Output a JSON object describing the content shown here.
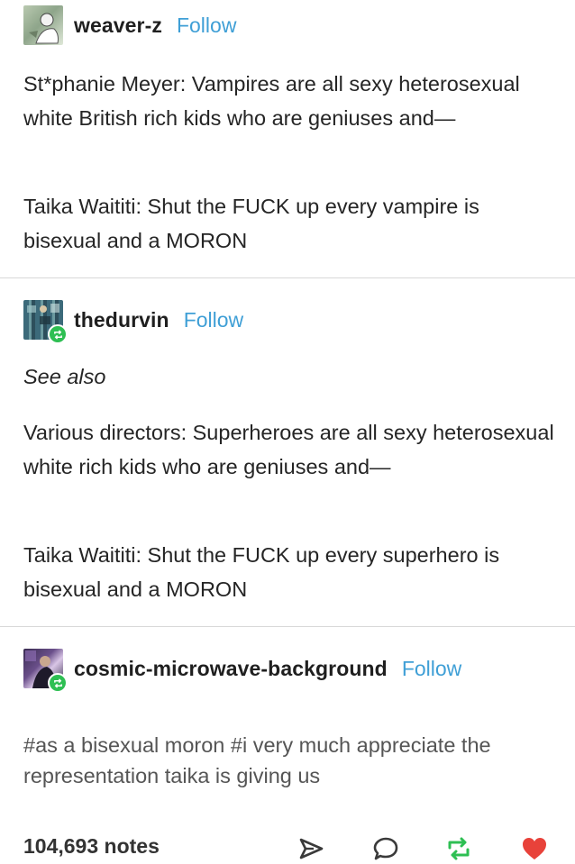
{
  "posts": [
    {
      "username": "weaver-z",
      "follow_label": "Follow",
      "paragraphs": [
        "St*phanie Meyer: Vampires are all sexy heterosexual white British rich kids who are geniuses and—",
        "Taika Waititi: Shut the FUCK up every vampire is bisexual and a MORON"
      ]
    },
    {
      "username": "thedurvin",
      "follow_label": "Follow",
      "paragraphs": [
        "See also",
        "Various directors: Superheroes are all sexy heterosexual white rich kids who are geniuses and—",
        "Taika Waititi: Shut the FUCK up every superhero is bisexual and a MORON"
      ]
    },
    {
      "username": "cosmic-microwave-background",
      "follow_label": "Follow",
      "tags": "#as a bisexual moron  #i very much appreciate the representation taika is giving us"
    }
  ],
  "footer": {
    "notes": "104,693 notes",
    "icons": [
      "share-icon",
      "reply-icon",
      "reblog-icon",
      "like-icon"
    ],
    "like_color": "#e8423a",
    "reblog_color": "#2ebf53"
  },
  "colors": {
    "follow": "#3f9fd6",
    "text": "#252525"
  }
}
